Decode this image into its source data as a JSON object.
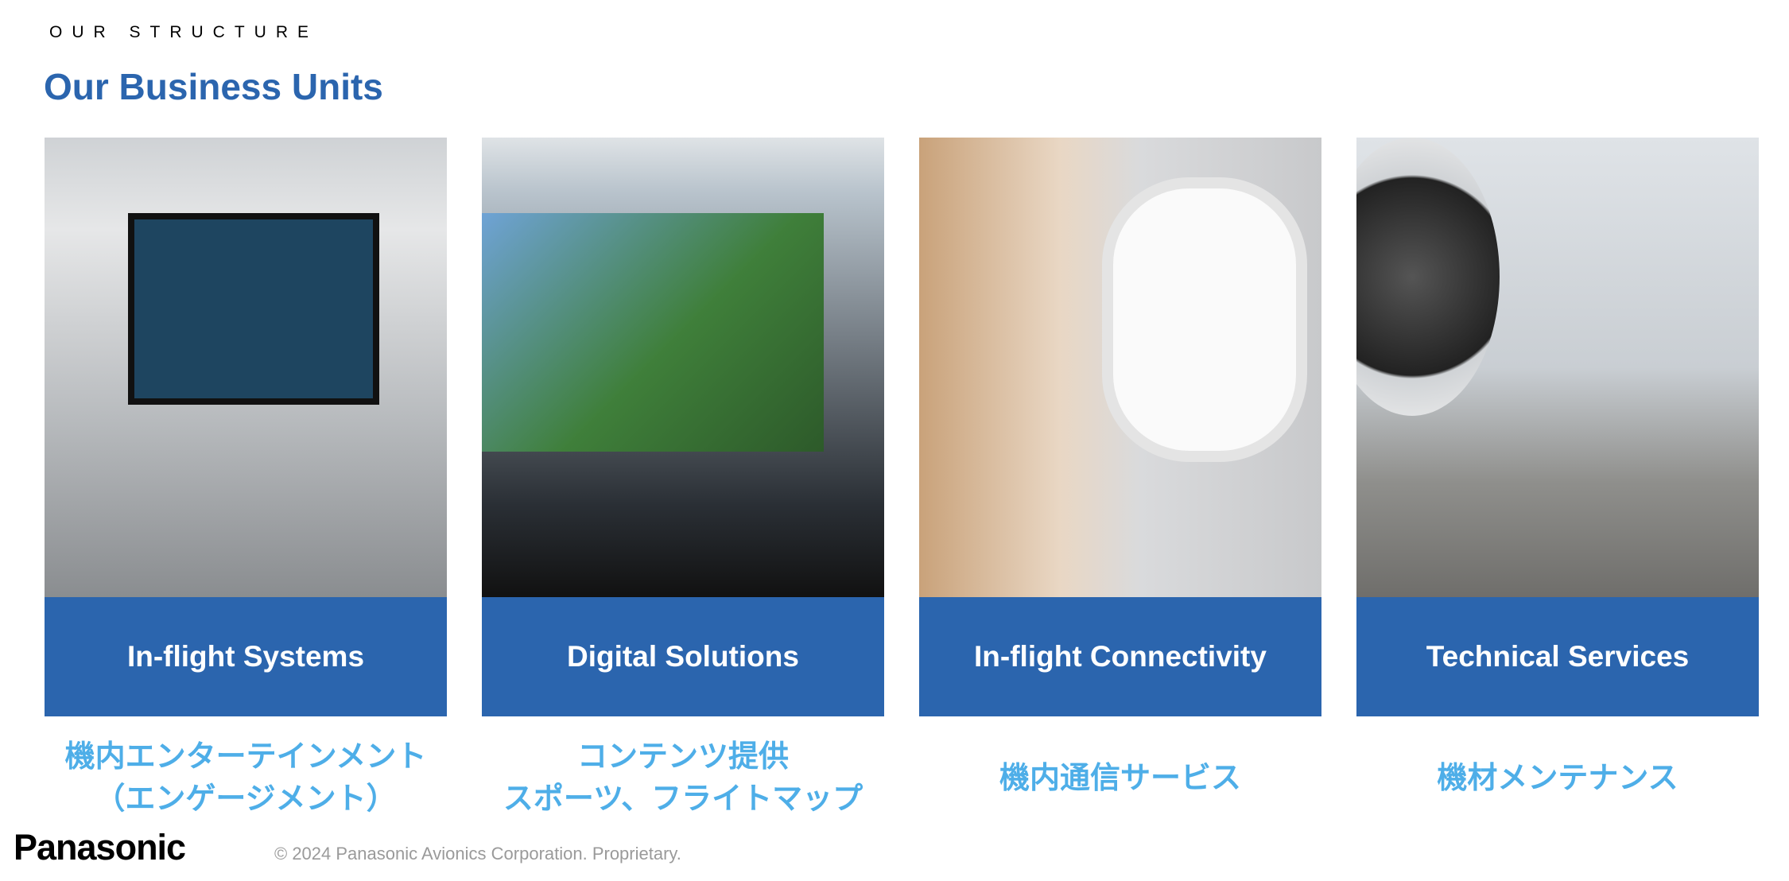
{
  "header": {
    "eyebrow": "OUR STRUCTURE",
    "title": "Our Business Units"
  },
  "colors": {
    "brand_blue": "#2B65AE",
    "japanese_text": "#4EAEE8"
  },
  "units": [
    {
      "label": "In-flight Systems",
      "jp_lines": [
        "機内エンターテインメント",
        "（エンゲージメント）"
      ],
      "image": "seatback-screen-photo"
    },
    {
      "label": "Digital Solutions",
      "jp_lines": [
        "コンテンツ提供",
        "スポーツ、フライトマップ"
      ],
      "image": "football-on-seat-screen-photo"
    },
    {
      "label": "In-flight Connectivity",
      "jp_lines": [
        "機内通信サービス"
      ],
      "image": "passenger-with-phone-photo"
    },
    {
      "label": "Technical Services",
      "jp_lines": [
        "機材メンテナンス"
      ],
      "image": "technicians-by-aircraft-photo"
    }
  ],
  "footer": {
    "logo": "Panasonic",
    "copyright": "© 2024 Panasonic Avionics Corporation. Proprietary."
  }
}
